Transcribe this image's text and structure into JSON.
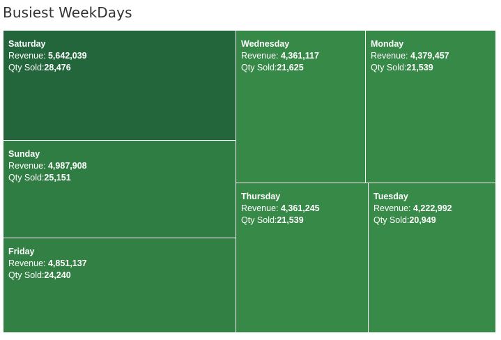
{
  "title": "Busiest WeekDays",
  "labels": {
    "revenue_prefix": "Revenue: ",
    "qty_prefix": "Qty Sold:"
  },
  "chart_data": {
    "type": "treemap",
    "title": "Busiest WeekDays",
    "size_by": "Revenue",
    "color_by": "Revenue",
    "color_low": "#378a47",
    "color_high": "#23663b",
    "items": [
      {
        "day": "Saturday",
        "revenue": 5642039,
        "revenue_label": "5,642,039",
        "qty": 28476,
        "qty_label": "28,476"
      },
      {
        "day": "Sunday",
        "revenue": 4987908,
        "revenue_label": "4,987,908",
        "qty": 25151,
        "qty_label": "25,151"
      },
      {
        "day": "Friday",
        "revenue": 4851137,
        "revenue_label": "4,851,137",
        "qty": 24240,
        "qty_label": "24,240"
      },
      {
        "day": "Wednesday",
        "revenue": 4361117,
        "revenue_label": "4,361,117",
        "qty": 21625,
        "qty_label": "21,625"
      },
      {
        "day": "Monday",
        "revenue": 4379457,
        "revenue_label": "4,379,457",
        "qty": 21539,
        "qty_label": "21,539"
      },
      {
        "day": "Thursday",
        "revenue": 4361245,
        "revenue_label": "4,361,245",
        "qty": 21539,
        "qty_label": "21,539"
      },
      {
        "day": "Tuesday",
        "revenue": 4222992,
        "revenue_label": "4,222,992",
        "qty": 20949,
        "qty_label": "20,949"
      }
    ]
  }
}
